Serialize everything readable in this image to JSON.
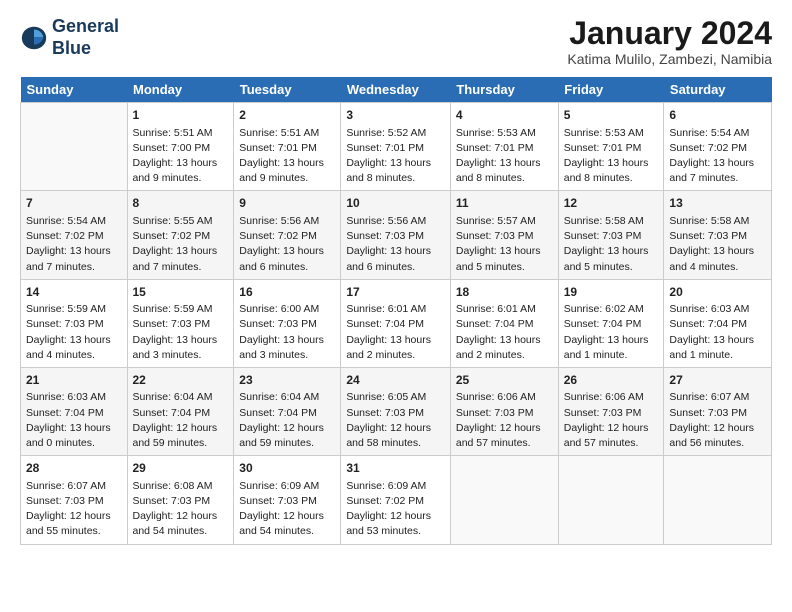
{
  "header": {
    "logo_line1": "General",
    "logo_line2": "Blue",
    "month": "January 2024",
    "location": "Katima Mulilo, Zambezi, Namibia"
  },
  "days_of_week": [
    "Sunday",
    "Monday",
    "Tuesday",
    "Wednesday",
    "Thursday",
    "Friday",
    "Saturday"
  ],
  "weeks": [
    [
      {
        "day": "",
        "sunrise": "",
        "sunset": "",
        "daylight": ""
      },
      {
        "day": "1",
        "sunrise": "Sunrise: 5:51 AM",
        "sunset": "Sunset: 7:00 PM",
        "daylight": "Daylight: 13 hours and 9 minutes."
      },
      {
        "day": "2",
        "sunrise": "Sunrise: 5:51 AM",
        "sunset": "Sunset: 7:01 PM",
        "daylight": "Daylight: 13 hours and 9 minutes."
      },
      {
        "day": "3",
        "sunrise": "Sunrise: 5:52 AM",
        "sunset": "Sunset: 7:01 PM",
        "daylight": "Daylight: 13 hours and 8 minutes."
      },
      {
        "day": "4",
        "sunrise": "Sunrise: 5:53 AM",
        "sunset": "Sunset: 7:01 PM",
        "daylight": "Daylight: 13 hours and 8 minutes."
      },
      {
        "day": "5",
        "sunrise": "Sunrise: 5:53 AM",
        "sunset": "Sunset: 7:01 PM",
        "daylight": "Daylight: 13 hours and 8 minutes."
      },
      {
        "day": "6",
        "sunrise": "Sunrise: 5:54 AM",
        "sunset": "Sunset: 7:02 PM",
        "daylight": "Daylight: 13 hours and 7 minutes."
      }
    ],
    [
      {
        "day": "7",
        "sunrise": "Sunrise: 5:54 AM",
        "sunset": "Sunset: 7:02 PM",
        "daylight": "Daylight: 13 hours and 7 minutes."
      },
      {
        "day": "8",
        "sunrise": "Sunrise: 5:55 AM",
        "sunset": "Sunset: 7:02 PM",
        "daylight": "Daylight: 13 hours and 7 minutes."
      },
      {
        "day": "9",
        "sunrise": "Sunrise: 5:56 AM",
        "sunset": "Sunset: 7:02 PM",
        "daylight": "Daylight: 13 hours and 6 minutes."
      },
      {
        "day": "10",
        "sunrise": "Sunrise: 5:56 AM",
        "sunset": "Sunset: 7:03 PM",
        "daylight": "Daylight: 13 hours and 6 minutes."
      },
      {
        "day": "11",
        "sunrise": "Sunrise: 5:57 AM",
        "sunset": "Sunset: 7:03 PM",
        "daylight": "Daylight: 13 hours and 5 minutes."
      },
      {
        "day": "12",
        "sunrise": "Sunrise: 5:58 AM",
        "sunset": "Sunset: 7:03 PM",
        "daylight": "Daylight: 13 hours and 5 minutes."
      },
      {
        "day": "13",
        "sunrise": "Sunrise: 5:58 AM",
        "sunset": "Sunset: 7:03 PM",
        "daylight": "Daylight: 13 hours and 4 minutes."
      }
    ],
    [
      {
        "day": "14",
        "sunrise": "Sunrise: 5:59 AM",
        "sunset": "Sunset: 7:03 PM",
        "daylight": "Daylight: 13 hours and 4 minutes."
      },
      {
        "day": "15",
        "sunrise": "Sunrise: 5:59 AM",
        "sunset": "Sunset: 7:03 PM",
        "daylight": "Daylight: 13 hours and 3 minutes."
      },
      {
        "day": "16",
        "sunrise": "Sunrise: 6:00 AM",
        "sunset": "Sunset: 7:03 PM",
        "daylight": "Daylight: 13 hours and 3 minutes."
      },
      {
        "day": "17",
        "sunrise": "Sunrise: 6:01 AM",
        "sunset": "Sunset: 7:04 PM",
        "daylight": "Daylight: 13 hours and 2 minutes."
      },
      {
        "day": "18",
        "sunrise": "Sunrise: 6:01 AM",
        "sunset": "Sunset: 7:04 PM",
        "daylight": "Daylight: 13 hours and 2 minutes."
      },
      {
        "day": "19",
        "sunrise": "Sunrise: 6:02 AM",
        "sunset": "Sunset: 7:04 PM",
        "daylight": "Daylight: 13 hours and 1 minute."
      },
      {
        "day": "20",
        "sunrise": "Sunrise: 6:03 AM",
        "sunset": "Sunset: 7:04 PM",
        "daylight": "Daylight: 13 hours and 1 minute."
      }
    ],
    [
      {
        "day": "21",
        "sunrise": "Sunrise: 6:03 AM",
        "sunset": "Sunset: 7:04 PM",
        "daylight": "Daylight: 13 hours and 0 minutes."
      },
      {
        "day": "22",
        "sunrise": "Sunrise: 6:04 AM",
        "sunset": "Sunset: 7:04 PM",
        "daylight": "Daylight: 12 hours and 59 minutes."
      },
      {
        "day": "23",
        "sunrise": "Sunrise: 6:04 AM",
        "sunset": "Sunset: 7:04 PM",
        "daylight": "Daylight: 12 hours and 59 minutes."
      },
      {
        "day": "24",
        "sunrise": "Sunrise: 6:05 AM",
        "sunset": "Sunset: 7:03 PM",
        "daylight": "Daylight: 12 hours and 58 minutes."
      },
      {
        "day": "25",
        "sunrise": "Sunrise: 6:06 AM",
        "sunset": "Sunset: 7:03 PM",
        "daylight": "Daylight: 12 hours and 57 minutes."
      },
      {
        "day": "26",
        "sunrise": "Sunrise: 6:06 AM",
        "sunset": "Sunset: 7:03 PM",
        "daylight": "Daylight: 12 hours and 57 minutes."
      },
      {
        "day": "27",
        "sunrise": "Sunrise: 6:07 AM",
        "sunset": "Sunset: 7:03 PM",
        "daylight": "Daylight: 12 hours and 56 minutes."
      }
    ],
    [
      {
        "day": "28",
        "sunrise": "Sunrise: 6:07 AM",
        "sunset": "Sunset: 7:03 PM",
        "daylight": "Daylight: 12 hours and 55 minutes."
      },
      {
        "day": "29",
        "sunrise": "Sunrise: 6:08 AM",
        "sunset": "Sunset: 7:03 PM",
        "daylight": "Daylight: 12 hours and 54 minutes."
      },
      {
        "day": "30",
        "sunrise": "Sunrise: 6:09 AM",
        "sunset": "Sunset: 7:03 PM",
        "daylight": "Daylight: 12 hours and 54 minutes."
      },
      {
        "day": "31",
        "sunrise": "Sunrise: 6:09 AM",
        "sunset": "Sunset: 7:02 PM",
        "daylight": "Daylight: 12 hours and 53 minutes."
      },
      {
        "day": "",
        "sunrise": "",
        "sunset": "",
        "daylight": ""
      },
      {
        "day": "",
        "sunrise": "",
        "sunset": "",
        "daylight": ""
      },
      {
        "day": "",
        "sunrise": "",
        "sunset": "",
        "daylight": ""
      }
    ]
  ]
}
